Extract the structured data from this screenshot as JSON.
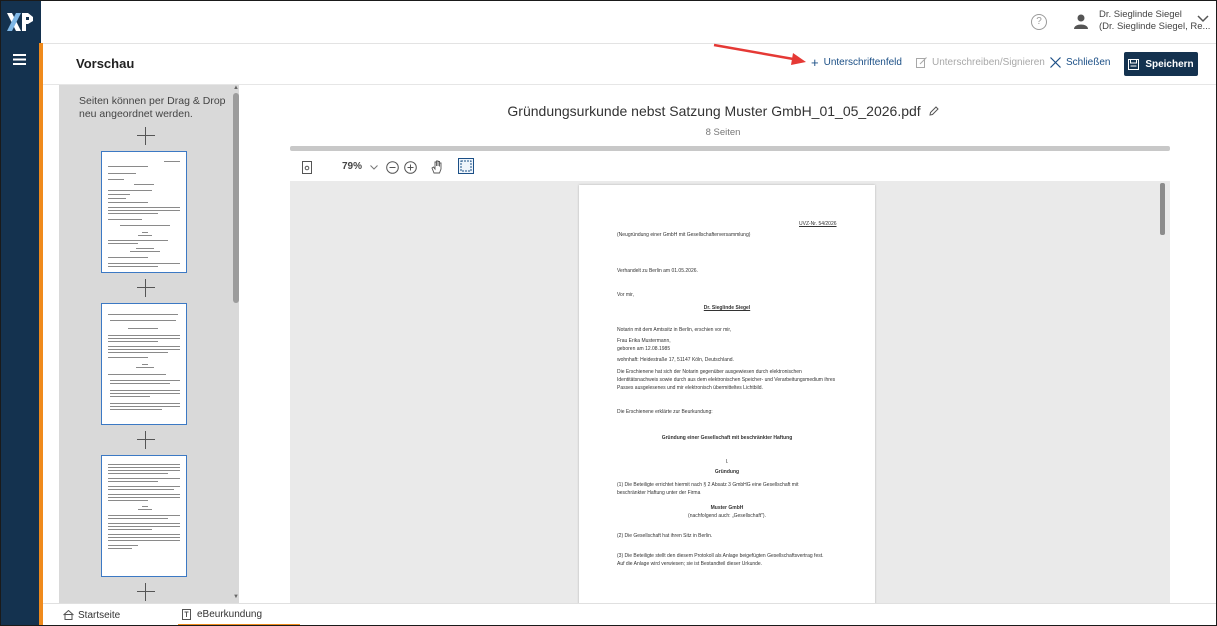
{
  "app": {
    "logo_text": "XP"
  },
  "topbar": {
    "help_icon": "?",
    "user_line1": "Dr. Sieglinde Siegel",
    "user_line2": "(Dr. Sieglinde Siegel, Re..."
  },
  "header": {
    "title": "Vorschau",
    "btn_signature_field": "Unterschriftenfeld",
    "btn_sign": "Unterschreiben/Signieren",
    "btn_close": "Schließen",
    "btn_save": "Speichern"
  },
  "thumbs": {
    "hint": "Seiten können per Drag & Drop neu angeordnet werden."
  },
  "document": {
    "title": "Gründungsurkunde nebst Satzung Muster GmbH_01_05_2026.pdf",
    "pages_label": "8 Seiten",
    "zoom": "79%"
  },
  "page": {
    "urnr": "UVZ-Nr.      54/2026",
    "line1": "(Neugründung einer GmbH mit Gesellschafterversammlung)",
    "line2": "Verhandelt zu Berlin am 01.05.2026.",
    "line3": "Vor mir,",
    "notary": "Dr. Sieglinde Siegel",
    "line4": "Notarin mit dem Amtssitz in Berlin, erschien vor mir,",
    "line5": "Frau Erika Mustermann,",
    "line6": "geboren am 12.08.1985",
    "line7": "wohnhaft: Heidestraße 17, 51147 Köln, Deutschland.",
    "line8": "Die Erschienene hat sich der Notarin gegenüber ausgewiesen durch elektronischen",
    "line9": "Identitätsnachweis sowie durch aus dem elektronischen Speicher- und Verarbeitungsmedium ihres",
    "line10": "Passes ausgelesenes und mir elektronisch übermitteltes Lichtbild.",
    "line11": "Die Erschienene erklärte zur Beurkundung:",
    "heading1": "Gründung einer Gesellschaft mit beschränkter Haftung",
    "section_num": "I.",
    "section_title": "Gründung",
    "p1a": "(1)   Die Beteiligte errichtet hiermit nach § 2 Absatz 3 GmbHG eine Gesellschaft mit",
    "p1b": "        beschränkter Haftung unter der Firma",
    "company": "Muster GmbH",
    "company_note": "(nachfolgend auch: „Gesellschaft\").",
    "p2": "(2)   Die Gesellschaft hat ihren Sitz in Berlin.",
    "p3a": "(3)   Die Beteiligte stellt den diesem Protokoll als Anlage beigefügten Gesellschaftsvertrag fest.",
    "p3b": "        Auf die Anlage wird verwiesen; sie ist Bestandteil dieser Urkunde."
  },
  "tabs": [
    {
      "label": "Startseite",
      "icon": "home-icon"
    },
    {
      "label": "eBeurkundung",
      "icon": "document-tab-icon"
    }
  ],
  "colors": {
    "navy": "#14324f",
    "accent": "#ef8a1c",
    "link": "#1b4f86",
    "arrow": "#e53935"
  }
}
